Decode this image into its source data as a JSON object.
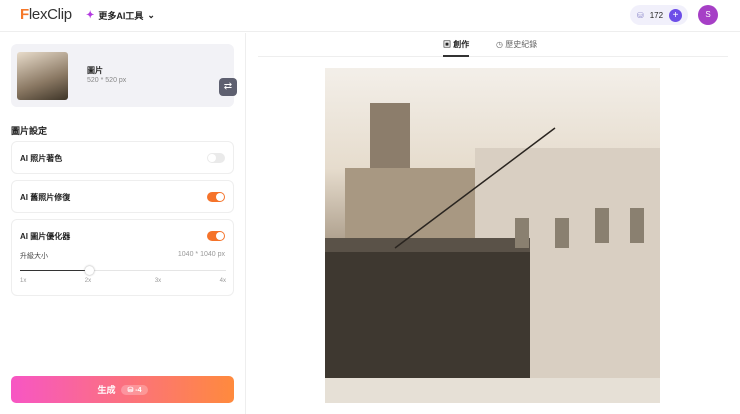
{
  "header": {
    "logo_prefix": "F",
    "logo_rest": "lexClip",
    "ai_tools": "更多AI工具",
    "credits": "172",
    "avatar_initial": "S"
  },
  "image": {
    "name": "圖片",
    "size": "520 * 520 px"
  },
  "settings": {
    "title": "圖片設定",
    "colorize": {
      "label": "AI 照片著色",
      "enabled": false
    },
    "restore": {
      "label": "AI 舊照片修復",
      "enabled": true
    },
    "enhance": {
      "label": "AI 圖片優化器",
      "enabled": true,
      "upscale_label": "升級大小",
      "resolution": "1040 * 1040 px",
      "scale": "2x",
      "ticks": [
        "1x",
        "2x",
        "3x",
        "4x"
      ]
    }
  },
  "generate": {
    "label": "生成",
    "cost": "-4"
  },
  "tabs": {
    "create": "創作",
    "history": "歷史紀錄"
  },
  "colors": {
    "accent": "#f5732a",
    "brand": "#6d4ee8"
  }
}
